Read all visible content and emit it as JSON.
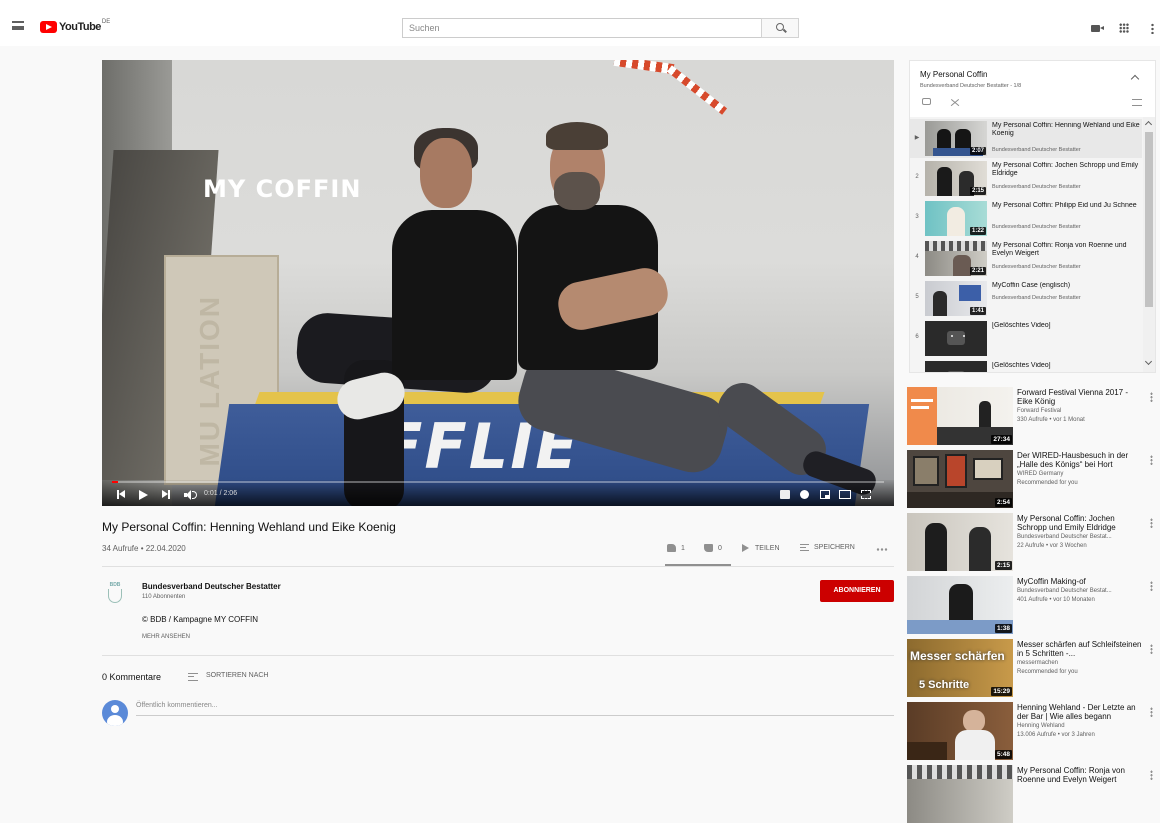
{
  "masthead": {
    "logo_text": "YouTube",
    "country": "DE",
    "search_placeholder": "Suchen"
  },
  "player": {
    "overlay_title": "MY COFFIN",
    "coffin_text": "FFLIE",
    "side_text": "MU LATION",
    "time": "0:01 / 2:06",
    "progress_fraction": 0.008
  },
  "video": {
    "title": "My Personal Coffin: Henning Wehland und Eike Koenig",
    "meta": "34 Aufrufe • 22.04.2020",
    "likes": "1",
    "dislikes": "0",
    "share_label": "TEILEN",
    "save_label": "SPEICHERN"
  },
  "channel": {
    "logo_text": "BDB",
    "name": "Bundesverband Deutscher Bestatter",
    "subscribers": "110 Abonnenten",
    "subscribe_label": "ABONNIEREN",
    "description": "© BDB / Kampagne MY COFFIN",
    "show_more": "MEHR ANSEHEN"
  },
  "comments": {
    "count_label": "0 Kommentare",
    "sort_label": "SORTIEREN NACH",
    "input_placeholder": "Öffentlich kommentieren..."
  },
  "playlist": {
    "title": "My Personal Coffin",
    "subtitle": "Bundesverband Deutscher Bestatter - 1/8",
    "items": [
      {
        "index": "▶",
        "title": "My Personal Coffin: Henning Wehland und Eike Koenig",
        "channel": "Bundesverband Deutscher Bestatter",
        "duration": "2:07"
      },
      {
        "index": "2",
        "title": "My Personal Coffin: Jochen Schropp und Emily Eldridge",
        "channel": "Bundesverband Deutscher Bestatter",
        "duration": "2:15"
      },
      {
        "index": "3",
        "title": "My Personal Coffin: Philipp Eid und Ju Schnee",
        "channel": "Bundesverband Deutscher Bestatter",
        "duration": "1:22"
      },
      {
        "index": "4",
        "title": "My Personal Coffin: Ronja von Roenne und Evelyn Weigert",
        "channel": "Bundesverband Deutscher Bestatter",
        "duration": "2:21"
      },
      {
        "index": "5",
        "title": "MyCoffin Case (englisch)",
        "channel": "Bundesverband Deutscher Bestatter",
        "duration": "1:41"
      },
      {
        "index": "6",
        "title": "[Gelöschtes Video]",
        "channel": "",
        "duration": ""
      },
      {
        "index": "7",
        "title": "[Gelöschtes Video]",
        "channel": "",
        "duration": ""
      }
    ]
  },
  "recommendations": [
    {
      "title": "Forward Festival Vienna 2017 - Eike König",
      "channel": "Forward Festival",
      "stats": "330 Aufrufe • vor 1 Monat",
      "duration": "27:34"
    },
    {
      "title": "Der WIRED-Hausbesuch in der „Halle des Königs“ bei Hort",
      "channel": "WIRED Germany",
      "stats": "Recommended for you",
      "duration": "2:54"
    },
    {
      "title": "My Personal Coffin: Jochen Schropp und Emily Eldridge",
      "channel": "Bundesverband Deutscher Bestat...",
      "stats": "22 Aufrufe • vor 3 Wochen",
      "duration": "2:15"
    },
    {
      "title": "MyCoffin Making-of",
      "channel": "Bundesverband Deutscher Bestat...",
      "stats": "401 Aufrufe • vor 10 Monaten",
      "duration": "1:38"
    },
    {
      "title": "Messer schärfen auf Schleifsteinen in 5 Schritten -...",
      "channel": "messermachen",
      "stats": "Recommended for you",
      "duration": "15:29",
      "overlay_top": "Messer schärfen",
      "overlay_bottom": "5 Schritte"
    },
    {
      "title": "Henning Wehland - Der Letzte an der Bar | Wie alles begann",
      "channel": "Henning Wehland",
      "stats": "13.006 Aufrufe • vor 3 Jahren",
      "duration": "5:48"
    },
    {
      "title": "My Personal Coffin: Ronja von Roenne und Evelyn Weigert",
      "channel": "",
      "stats": "",
      "duration": ""
    }
  ],
  "colors": {
    "brand_red": "#ff0000",
    "subscribe_red": "#cc0000"
  }
}
